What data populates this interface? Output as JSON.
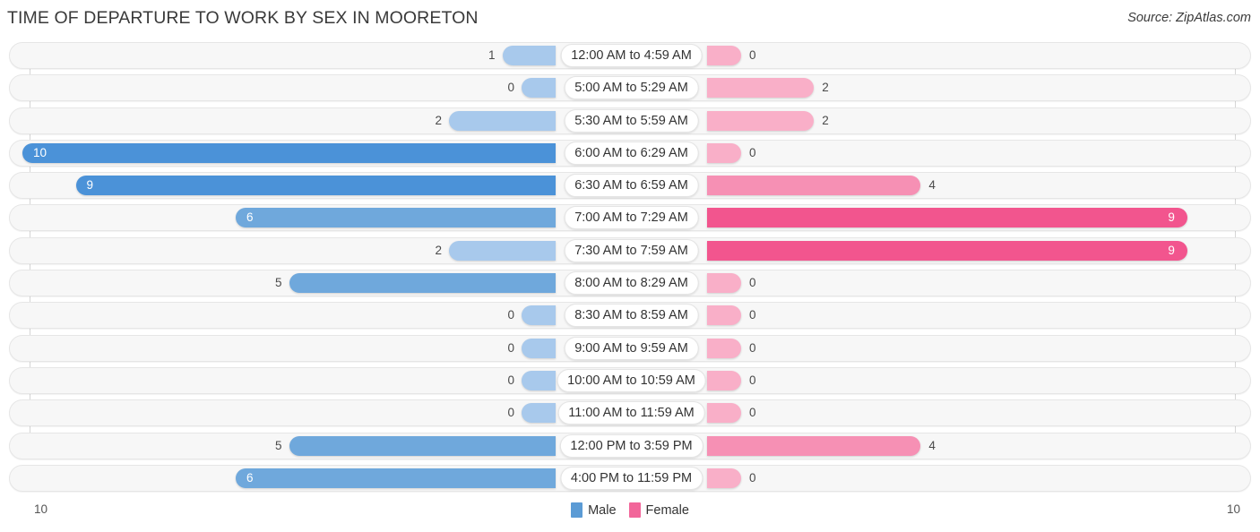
{
  "header": {
    "title": "TIME OF DEPARTURE TO WORK BY SEX IN MOORETON",
    "source": "Source: ZipAtlas.com"
  },
  "legend": {
    "male_label": "Male",
    "female_label": "Female",
    "male_color": "#5B9BD5",
    "female_color": "#F2669A"
  },
  "axis": {
    "left_max_label": "10",
    "right_max_label": "10",
    "max": 10
  },
  "chart_data": {
    "type": "bar",
    "orientation": "horizontal-diverging",
    "title": "TIME OF DEPARTURE TO WORK BY SEX IN MOORETON",
    "xlabel": "",
    "ylabel": "",
    "xlim": [
      10,
      10
    ],
    "grid": true,
    "legend_position": "bottom-center",
    "categories": [
      "12:00 AM to 4:59 AM",
      "5:00 AM to 5:29 AM",
      "5:30 AM to 5:59 AM",
      "6:00 AM to 6:29 AM",
      "6:30 AM to 6:59 AM",
      "7:00 AM to 7:29 AM",
      "7:30 AM to 7:59 AM",
      "8:00 AM to 8:29 AM",
      "8:30 AM to 8:59 AM",
      "9:00 AM to 9:59 AM",
      "10:00 AM to 10:59 AM",
      "11:00 AM to 11:59 AM",
      "12:00 PM to 3:59 PM",
      "4:00 PM to 11:59 PM"
    ],
    "series": [
      {
        "name": "Male",
        "side": "left",
        "values": [
          1,
          0,
          2,
          10,
          9,
          6,
          2,
          5,
          0,
          0,
          0,
          0,
          5,
          6
        ]
      },
      {
        "name": "Female",
        "side": "right",
        "values": [
          0,
          2,
          2,
          0,
          4,
          9,
          9,
          0,
          0,
          0,
          0,
          0,
          4,
          0
        ]
      }
    ],
    "value_labels": {
      "male": [
        "1",
        "0",
        "2",
        "10",
        "9",
        "6",
        "2",
        "5",
        "0",
        "0",
        "0",
        "0",
        "5",
        "6"
      ],
      "female": [
        "0",
        "2",
        "2",
        "0",
        "4",
        "9",
        "9",
        "0",
        "0",
        "0",
        "0",
        "0",
        "4",
        "0"
      ]
    }
  }
}
